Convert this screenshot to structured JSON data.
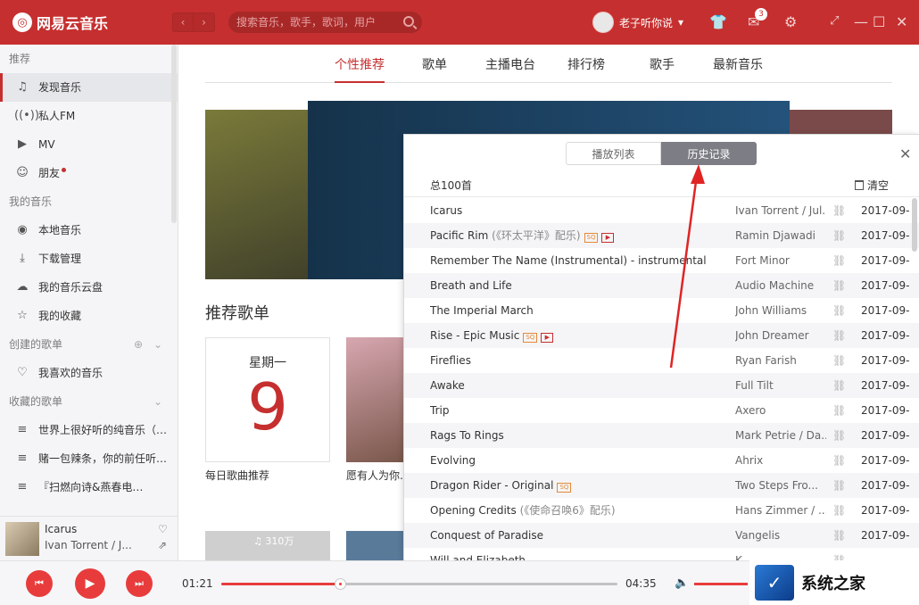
{
  "app": {
    "name": "网易云音乐",
    "accent": "#c62f2f"
  },
  "header": {
    "search_placeholder": "搜索音乐，歌手，歌词，用户",
    "username": "老子听你说",
    "message_count": "3"
  },
  "sidebar": {
    "groups": {
      "recommend": "推荐",
      "my_music": "我的音乐",
      "created": "创建的歌单",
      "collected": "收藏的歌单"
    },
    "recommend_items": [
      {
        "label": "发现音乐",
        "icon": "music-note-icon"
      },
      {
        "label": "私人FM",
        "icon": "radio-icon"
      },
      {
        "label": "MV",
        "icon": "video-icon"
      },
      {
        "label": "朋友",
        "icon": "friends-icon"
      }
    ],
    "my_items": [
      {
        "label": "本地音乐",
        "icon": "disc-icon"
      },
      {
        "label": "下载管理",
        "icon": "download-icon"
      },
      {
        "label": "我的音乐云盘",
        "icon": "cloud-icon"
      },
      {
        "label": "我的收藏",
        "icon": "collection-icon"
      }
    ],
    "created_items": [
      {
        "label": "我喜欢的音乐",
        "icon": "heart-icon"
      }
    ],
    "collected_items": [
      {
        "label": "世界上很好听的纯音乐（…",
        "icon": "playlist-icon"
      },
      {
        "label": "赌一包辣条，你的前任听…",
        "icon": "playlist-icon"
      },
      {
        "label": "『扫燃向诗&燕春电…",
        "icon": "playlist-icon"
      }
    ]
  },
  "now_playing": {
    "title": "Icarus",
    "artist": "Ivan Torrent / J..."
  },
  "main": {
    "tabs": [
      "个性推荐",
      "歌单",
      "主播电台",
      "排行榜",
      "歌手",
      "最新音乐"
    ],
    "active_tab": 0,
    "section_title": "推荐歌单",
    "daily": {
      "weekday": "星期一",
      "day": "9",
      "label": "每日歌曲推荐"
    },
    "card2_label": "愿有人为你…清晨起身…",
    "card3_plays": "310万"
  },
  "history_panel": {
    "segments": [
      "播放列表",
      "历史记录"
    ],
    "active_segment": 1,
    "total": "总100首",
    "clear": "清空",
    "rows": [
      {
        "title": "Icarus",
        "artist": "Ivan Torrent / Jul...",
        "date": "2017-09-"
      },
      {
        "title": "Pacific Rim",
        "paren": "(《环太平洋》配乐)",
        "tags": [
          "SQ",
          "MV"
        ],
        "artist": "Ramin Djawadi",
        "date": "2017-09-"
      },
      {
        "title": "Remember The Name (Instrumental) - instrumental",
        "artist": "Fort Minor",
        "date": "2017-09-"
      },
      {
        "title": "Breath and Life",
        "artist": "Audio Machine",
        "date": "2017-09-"
      },
      {
        "title": "The Imperial March",
        "artist": "John Williams",
        "date": "2017-09-"
      },
      {
        "title": "Rise - Epic Music",
        "tags": [
          "SQ",
          "MV"
        ],
        "artist": "John Dreamer",
        "date": "2017-09-"
      },
      {
        "title": "Fireflies",
        "artist": "Ryan Farish",
        "date": "2017-09-"
      },
      {
        "title": "Awake",
        "artist": "Full Tilt",
        "date": "2017-09-"
      },
      {
        "title": "Trip",
        "artist": "Axero",
        "date": "2017-09-"
      },
      {
        "title": "Rags To Rings",
        "artist": "Mark Petrie / Da...",
        "date": "2017-09-"
      },
      {
        "title": "Evolving",
        "artist": "Ahrix",
        "date": "2017-09-"
      },
      {
        "title": "Dragon Rider - Original",
        "tags": [
          "SQ"
        ],
        "artist": "Two Steps Fro...",
        "date": "2017-09-"
      },
      {
        "title": "Opening Credits",
        "paren": "(《使命召唤6》配乐)",
        "artist": "Hans Zimmer / ...",
        "date": "2017-09-"
      },
      {
        "title": "Conquest of Paradise",
        "artist": "Vangelis",
        "date": "2017-09-"
      },
      {
        "title": "Will and Elizabeth",
        "artist": "K...",
        "date": ""
      }
    ]
  },
  "player": {
    "elapsed": "01:21",
    "duration": "04:35",
    "progress": 0.3
  },
  "watermark": {
    "text": "系统之家"
  }
}
